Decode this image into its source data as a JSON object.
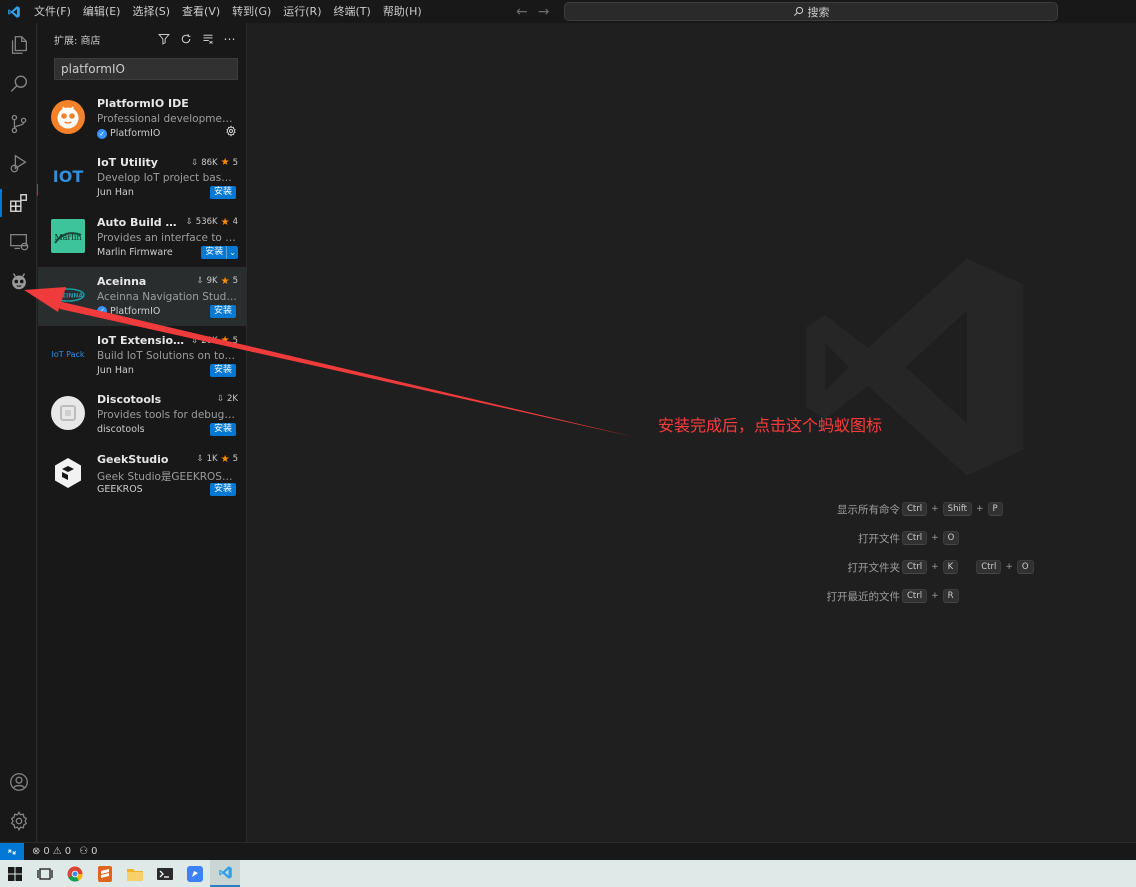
{
  "menu": [
    "文件(F)",
    "编辑(E)",
    "选择(S)",
    "查看(V)",
    "转到(G)",
    "运行(R)",
    "终端(T)",
    "帮助(H)"
  ],
  "command_center": {
    "label": "搜索"
  },
  "activity_bar": {
    "items": [
      "explorer-icon",
      "search-icon",
      "source-control-icon",
      "run-debug-icon",
      "extensions-icon",
      "remote-explorer-icon",
      "platformio-icon"
    ],
    "bottom": [
      "account-icon",
      "manage-gear-icon"
    ]
  },
  "sidebar": {
    "title": "扩展: 商店",
    "search_value": "platformIO",
    "extensions": [
      {
        "name": "PlatformIO IDE",
        "description": "Professional development e...",
        "publisher": "PlatformIO",
        "verified": true,
        "installed": true
      },
      {
        "name": "IoT Utility",
        "downloads": "86K",
        "rating": "5",
        "description": "Develop IoT project based o...",
        "publisher": "Jun Han",
        "action": "安装"
      },
      {
        "name": "Auto Build Ma...",
        "downloads": "536K",
        "rating": "4",
        "description": "Provides an interface to qui...",
        "publisher": "Marlin Firmware",
        "action": "安装"
      },
      {
        "name": "Aceinna",
        "downloads": "9K",
        "rating": "5",
        "description": "Aceinna Navigation Studio: ...",
        "publisher": "PlatformIO",
        "verified": true,
        "action": "安装"
      },
      {
        "name": "IoT Extension P...",
        "downloads": "20K",
        "rating": "5",
        "description": "Build IoT Solutions on top o...",
        "publisher": "Jun Han",
        "action": "安装"
      },
      {
        "name": "Discotools",
        "downloads": "2K",
        "description": "Provides tools for debuggin...",
        "publisher": "discotools",
        "action": "安装"
      },
      {
        "name": "GeekStudio",
        "downloads": "1K",
        "rating": "5",
        "description": "Geek Studio是GEEKROS团队...",
        "publisher": "GEEKROS",
        "action": "安装"
      }
    ]
  },
  "editor": {
    "shortcuts": [
      {
        "label": "显示所有命令",
        "keys": [
          [
            "Ctrl",
            "Shift",
            "P"
          ]
        ]
      },
      {
        "label": "打开文件",
        "keys": [
          [
            "Ctrl",
            "O"
          ]
        ]
      },
      {
        "label": "打开文件夹",
        "keys": [
          [
            "Ctrl",
            "K"
          ],
          [
            "Ctrl",
            "O"
          ]
        ]
      },
      {
        "label": "打开最近的文件",
        "keys": [
          [
            "Ctrl",
            "R"
          ]
        ]
      }
    ]
  },
  "annotation": {
    "text": "安装完成后，点击这个蚂蚁图标",
    "color": "#ff3b3b"
  },
  "status_bar": {
    "errors": "0",
    "warnings": "0",
    "ports": "0"
  },
  "colors": {
    "accent": "#0078d4",
    "star": "#ff8e00",
    "background": "#1f1f1f",
    "sidebar": "#181818"
  }
}
